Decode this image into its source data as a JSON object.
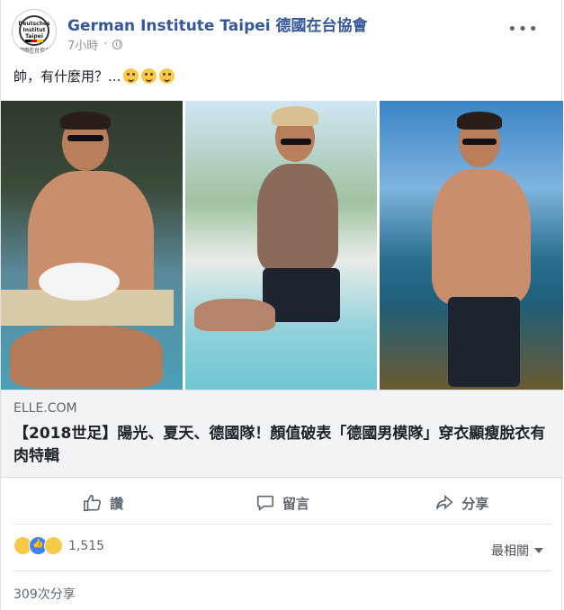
{
  "post": {
    "page_name": "German Institute Taipei 德國在台協會",
    "time": "7小時",
    "text": "帥，有什麼用？..."
  },
  "avatar": {
    "logo_lines": [
      "Deutsches",
      "Institut",
      "Taipei"
    ],
    "caption": "德國在台協會"
  },
  "link": {
    "domain": "ELLE.COM",
    "title": "【2018世足】陽光、夏天、德國隊！顏值破表「德國男模隊」穿衣顯瘦脫衣有肉特輯"
  },
  "actions": {
    "like": "讚",
    "comment": "留言",
    "share": "分享"
  },
  "reactions": {
    "count": "1,515",
    "sort": "最相關"
  },
  "shares": {
    "text": "309次分享"
  },
  "icons": [
    "more-icon",
    "globe-icon",
    "like-icon",
    "comment-icon",
    "share-icon",
    "caret-down-icon"
  ]
}
